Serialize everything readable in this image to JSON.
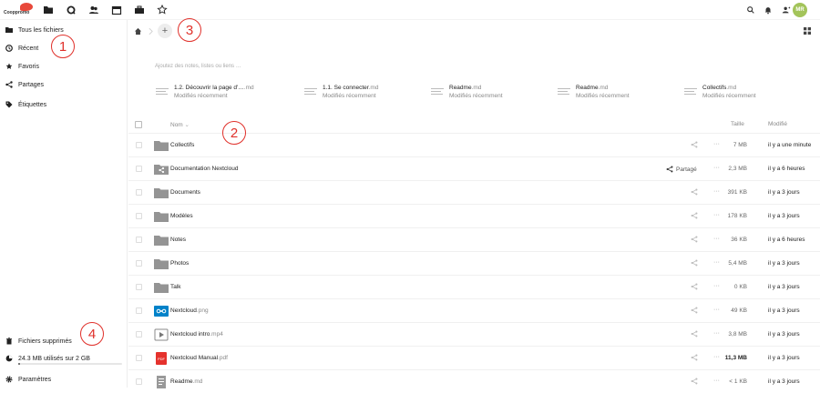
{
  "header": {
    "logo_text": "Cooppromo",
    "apps": [
      "files-icon",
      "search-icon",
      "contacts-icon",
      "calendar-icon",
      "briefcase-icon",
      "star-icon"
    ],
    "avatar_initials": "MR"
  },
  "sidebar": {
    "items": [
      {
        "label": "Tous les fichiers",
        "icon": "folder-icon"
      },
      {
        "label": "Récent",
        "icon": "clock-icon"
      },
      {
        "label": "Favoris",
        "icon": "star-icon"
      },
      {
        "label": "Partages",
        "icon": "share-icon"
      },
      {
        "label": "Étiquettes",
        "icon": "tag-icon"
      }
    ],
    "bottom": {
      "deleted": "Fichiers supprimés",
      "quota": "24.3 MB utilisés sur 2 GB",
      "quota_fraction": 0.012,
      "settings": "Paramètres"
    }
  },
  "annotations": [
    "1",
    "2",
    "3",
    "4"
  ],
  "main": {
    "notes_placeholder": "Ajoutez des notes, listes ou liens …",
    "recent": [
      {
        "name": "1.2. Découvrir la page d'…",
        "ext": ".md",
        "sub": "Modifiés récemment"
      },
      {
        "name": "1.1. Se connecter",
        "ext": ".md",
        "sub": "Modifiés récemment"
      },
      {
        "name": "Readme",
        "ext": ".md",
        "sub": "Modifiés récemment"
      },
      {
        "name": "Readme",
        "ext": ".md",
        "sub": "Modifiés récemment"
      },
      {
        "name": "Collectifs",
        "ext": ".md",
        "sub": "Modifiés récemment"
      }
    ],
    "columns": {
      "name": "Nom",
      "size": "Taille",
      "modified": "Modifié"
    },
    "shared_label": "Partagé",
    "files": [
      {
        "name": "Collectifs",
        "ext": "",
        "type": "folder",
        "size": "7 MB",
        "modified": "il y a une minute"
      },
      {
        "name": "Documentation Nextcloud",
        "ext": "",
        "type": "shared-folder",
        "size": "2,3 MB",
        "modified": "il y a 6 heures"
      },
      {
        "name": "Documents",
        "ext": "",
        "type": "folder",
        "size": "391 KB",
        "modified": "il y a 3 jours"
      },
      {
        "name": "Modèles",
        "ext": "",
        "type": "folder",
        "size": "178 KB",
        "modified": "il y a 3 jours"
      },
      {
        "name": "Notes",
        "ext": "",
        "type": "folder",
        "size": "36 KB",
        "modified": "il y a 6 heures"
      },
      {
        "name": "Photos",
        "ext": "",
        "type": "folder",
        "size": "5,4 MB",
        "modified": "il y a 3 jours"
      },
      {
        "name": "Talk",
        "ext": "",
        "type": "folder",
        "size": "0 KB",
        "modified": "il y a 3 jours"
      },
      {
        "name": "Nextcloud",
        "ext": ".png",
        "type": "image",
        "size": "49 KB",
        "modified": "il y a 3 jours"
      },
      {
        "name": "Nextcloud intro",
        "ext": ".mp4",
        "type": "video",
        "size": "3,8 MB",
        "modified": "il y a 3 jours"
      },
      {
        "name": "Nextcloud Manual",
        "ext": ".pdf",
        "type": "pdf",
        "size": "11,3 MB",
        "modified": "il y a 3 jours"
      },
      {
        "name": "Readme",
        "ext": ".md",
        "type": "text",
        "size": "< 1 KB",
        "modified": "il y a 3 jours"
      }
    ]
  }
}
